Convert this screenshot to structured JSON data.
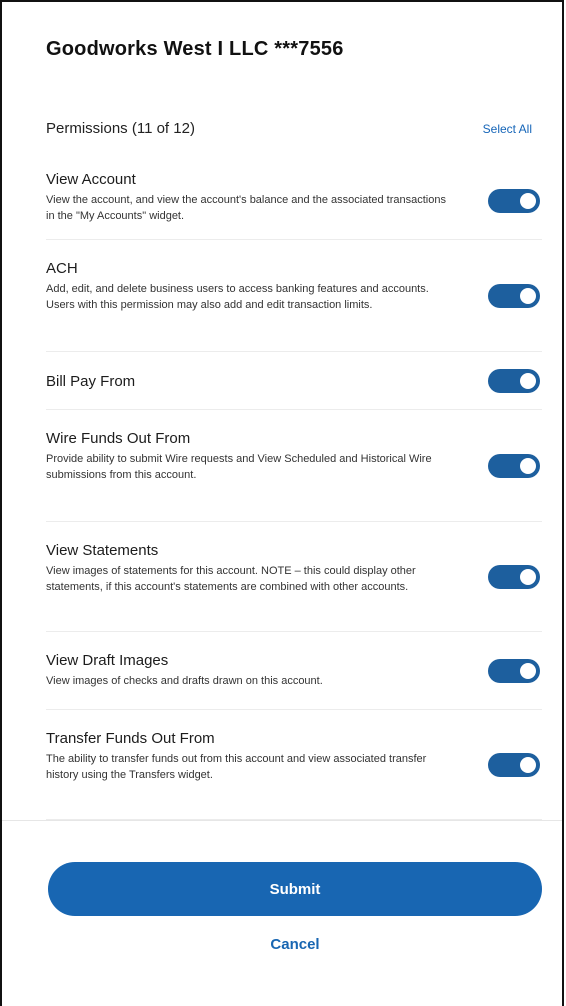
{
  "title": "Goodworks West I LLC ***7556",
  "permissions_header": {
    "count_label": "Permissions (11 of 12)",
    "select_all": "Select All"
  },
  "permissions": [
    {
      "name": "View Account",
      "description": "View the account, and view the account's balance and the associated transactions in the \"My Accounts\" widget.",
      "enabled": true
    },
    {
      "name": "ACH",
      "description": "Add, edit, and delete business users to access banking features and accounts. Users with this permission may also add and edit transaction limits.",
      "enabled": true
    },
    {
      "name": "Bill Pay From",
      "description": "",
      "enabled": true
    },
    {
      "name": "Wire Funds Out From",
      "description": "Provide ability to submit Wire requests and View Scheduled and Historical Wire submissions from this account.",
      "enabled": true
    },
    {
      "name": "View Statements",
      "description": "View images of statements for this account. NOTE – this could display other statements, if this account's statements are combined with other accounts.",
      "enabled": true
    },
    {
      "name": "View Draft Images",
      "description": "View images of checks and drafts drawn on this account.",
      "enabled": true
    },
    {
      "name": "Transfer Funds Out From",
      "description": "The ability to transfer funds out from this account and view associated transfer history using the Transfers widget.",
      "enabled": true
    }
  ],
  "actions": {
    "submit": "Submit",
    "cancel": "Cancel"
  },
  "colors": {
    "toggle_on": "#1d5f9e",
    "primary": "#1866b2"
  }
}
